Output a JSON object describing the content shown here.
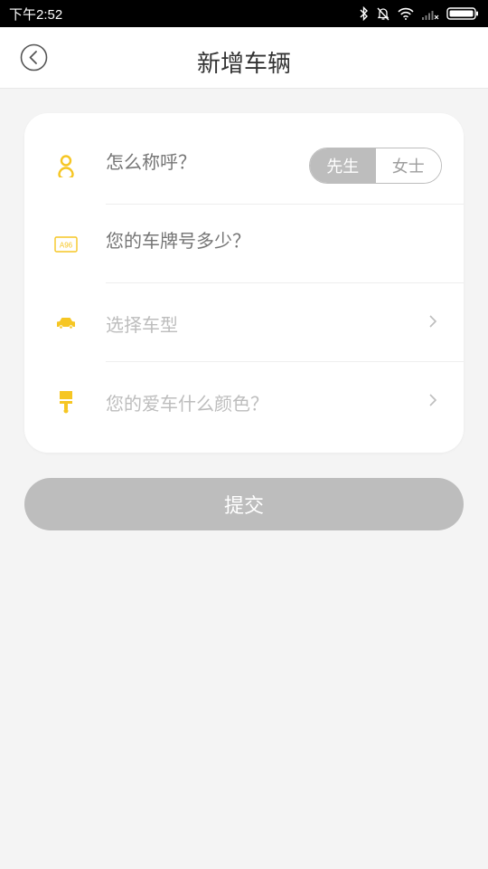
{
  "status_bar": {
    "time": "下午2:52",
    "icons": [
      "bluetooth-icon",
      "mute-icon",
      "wifi-icon",
      "signal-icon",
      "battery-icon"
    ]
  },
  "header": {
    "title": "新增车辆",
    "back_icon": "back-arrow-icon"
  },
  "form": {
    "rows": [
      {
        "icon": "person-icon",
        "placeholder": "怎么称呼？"
      },
      {
        "icon": "license-plate-icon",
        "placeholder": "您的车牌号多少？",
        "plate_text": "A96"
      },
      {
        "icon": "car-icon",
        "placeholder": "选择车型"
      },
      {
        "icon": "paint-brush-icon",
        "placeholder": "您的爱车什么颜色？"
      }
    ],
    "gender": {
      "options": [
        "先生",
        "女士"
      ],
      "selected": "先生"
    }
  },
  "submit": {
    "label": "提交"
  },
  "colors": {
    "accent": "#f6c623",
    "placeholder": "#bdbdbd",
    "button_disabled": "#bdbdbd",
    "background": "#f4f4f4"
  }
}
